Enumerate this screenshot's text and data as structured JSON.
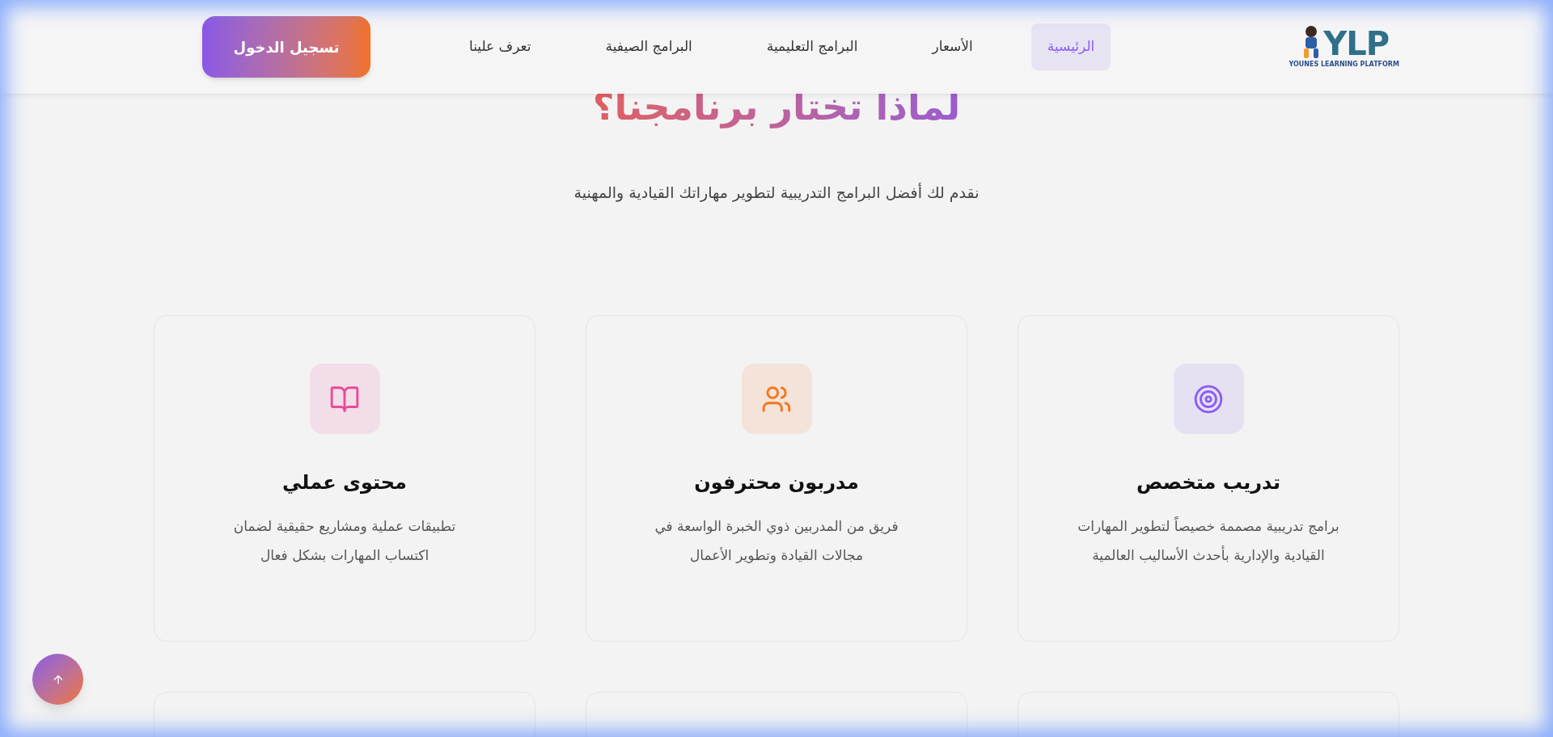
{
  "header": {
    "logo": {
      "text": "YLP",
      "tagline": "YOUNES LEARNING PLATFORM"
    },
    "nav": [
      {
        "label": "الرئيسية",
        "selected": true
      },
      {
        "label": "الأسعار",
        "selected": false
      },
      {
        "label": "البرامج التعليمية",
        "selected": false
      },
      {
        "label": "البرامج الصيفية",
        "selected": false
      },
      {
        "label": "تعرف علينا",
        "selected": false
      }
    ],
    "login_button": "تسجيل الدخول"
  },
  "section": {
    "title": "لماذا تختار برنامجنا؟",
    "subtitle": "نقدم لك أفضل البرامج التدريبية لتطوير مهاراتك القيادية والمهنية"
  },
  "features": [
    {
      "title": "تدريب متخصص",
      "text": "برامج تدريبية مصممة خصيصاً لتطوير المهارات القيادية والإدارية بأحدث الأساليب العالمية",
      "color": "#8b5cf6"
    },
    {
      "title": "مدربون محترفون",
      "text": "فريق من المدربين ذوي الخبرة الواسعة في مجالات القيادة وتطوير الأعمال",
      "color": "#f97316"
    },
    {
      "title": "محتوى عملي",
      "text": "تطبيقات عملية ومشاريع حقيقية لضمان اكتساب المهارات بشكل فعال",
      "color": "#ec4899"
    }
  ]
}
